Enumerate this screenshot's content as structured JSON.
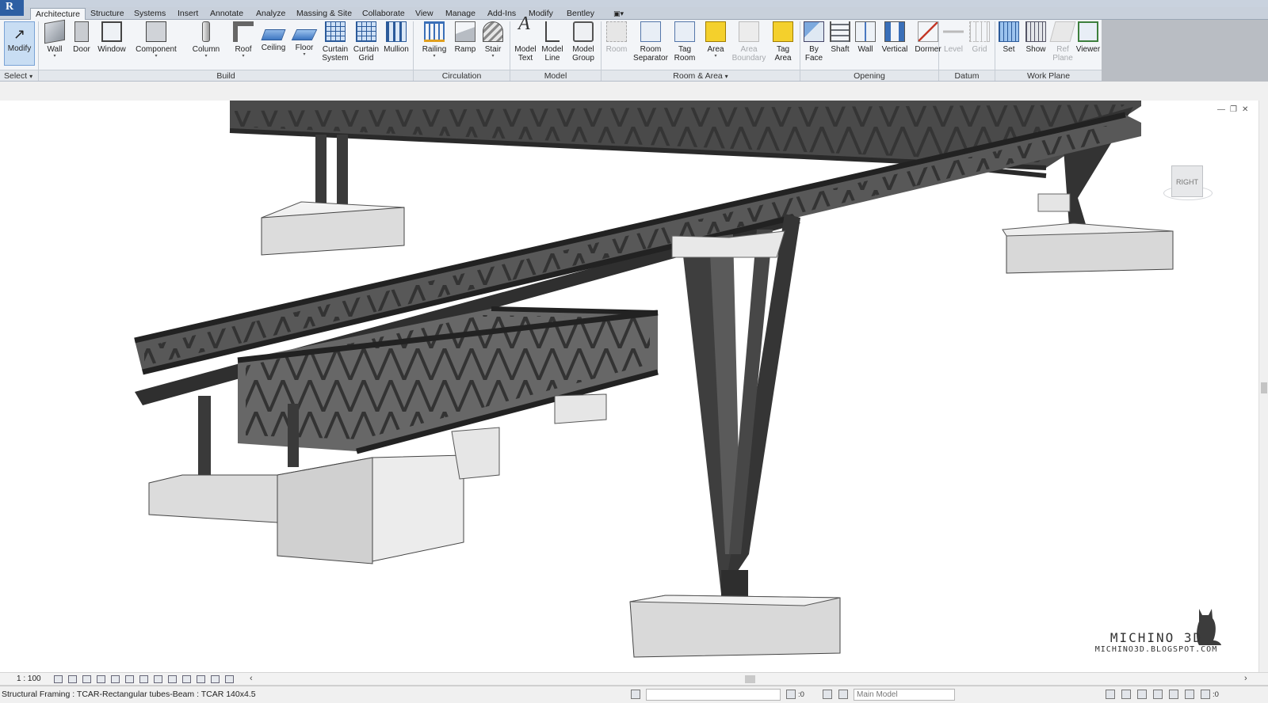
{
  "app": {
    "logo_letter": "R"
  },
  "tabs": [
    {
      "label": "Architecture",
      "active": true
    },
    {
      "label": "Structure"
    },
    {
      "label": "Systems"
    },
    {
      "label": "Insert"
    },
    {
      "label": "Annotate"
    },
    {
      "label": "Analyze"
    },
    {
      "label": "Massing & Site"
    },
    {
      "label": "Collaborate"
    },
    {
      "label": "View"
    },
    {
      "label": "Manage"
    },
    {
      "label": "Add-Ins"
    },
    {
      "label": "Modify"
    },
    {
      "label": "Bentley"
    }
  ],
  "ribbon": {
    "select": {
      "button": "Modify",
      "panel": "Select"
    },
    "build": {
      "panel": "Build",
      "wall": "Wall",
      "door": "Door",
      "window": "Window",
      "component": "Component",
      "column": "Column",
      "roof": "Roof",
      "ceiling": "Ceiling",
      "floor": "Floor",
      "curtain_system_1": "Curtain",
      "curtain_system_2": "System",
      "curtain_grid_1": "Curtain",
      "curtain_grid_2": "Grid",
      "mullion": "Mullion"
    },
    "circulation": {
      "panel": "Circulation",
      "railing": "Railing",
      "ramp": "Ramp",
      "stair": "Stair"
    },
    "model": {
      "panel": "Model",
      "model_text_1": "Model",
      "model_text_2": "Text",
      "model_line_1": "Model",
      "model_line_2": "Line",
      "model_group_1": "Model",
      "model_group_2": "Group"
    },
    "room_area": {
      "panel": "Room & Area",
      "room": "Room",
      "room_sep_1": "Room",
      "room_sep_2": "Separator",
      "tag_room_1": "Tag",
      "tag_room_2": "Room",
      "area": "Area",
      "area_boundary_1": "Area",
      "area_boundary_2": "Boundary",
      "tag_area_1": "Tag",
      "tag_area_2": "Area"
    },
    "opening": {
      "panel": "Opening",
      "by_face_1": "By",
      "by_face_2": "Face",
      "shaft": "Shaft",
      "wall": "Wall",
      "vertical": "Vertical",
      "dormer": "Dormer"
    },
    "datum": {
      "panel": "Datum",
      "level": "Level",
      "grid": "Grid"
    },
    "work_plane": {
      "panel": "Work Plane",
      "set": "Set",
      "show": "Show",
      "ref_plane_1": "Ref",
      "ref_plane_2": "Plane",
      "viewer": "Viewer"
    }
  },
  "viewcube": {
    "face": "RIGHT"
  },
  "watermark": {
    "title": "MICHINO 3D",
    "url": "MICHINO3D.BLOGSPOT.COM"
  },
  "view_control": {
    "scale": "1 : 100"
  },
  "status": {
    "text": "Structural Framing : TCAR-Rectangular tubes-Beam : TCAR 140x4.5",
    "workset_zero": ":0",
    "model": "Main Model",
    "filter_zero": ":0"
  }
}
